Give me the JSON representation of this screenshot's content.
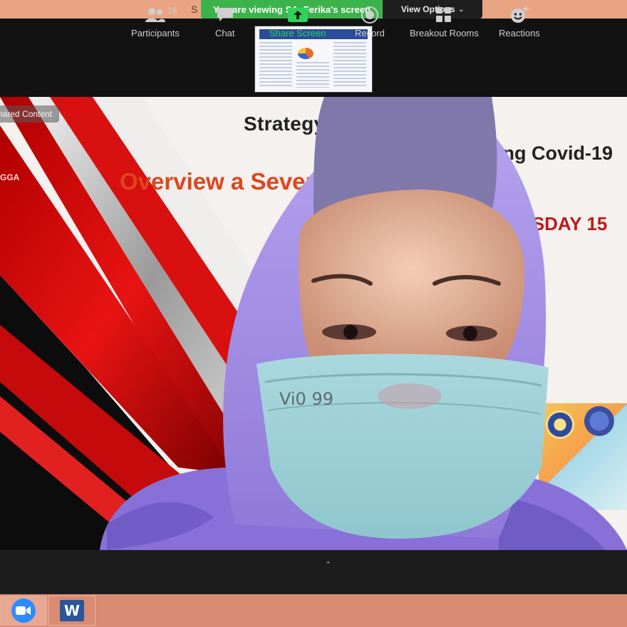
{
  "top_bar": {
    "partial_text": "S",
    "viewing_label": "You are viewing SA_Ferika's screen",
    "view_options_label": "View Options"
  },
  "shared_content": {
    "label": "hared Content",
    "slide": {
      "title_line1": "Strategy of        and Faculty of",
      "title_line2": "ing Covid-19",
      "overview": "Overview a            Several C",
      "date": "RSDAY 15",
      "speaker": "GGA"
    }
  },
  "toolbar": {
    "participants": {
      "label": "Participants",
      "count": "16"
    },
    "chat": {
      "label": "Chat"
    },
    "share_screen": {
      "label": "Share Screen"
    },
    "record": {
      "label": "Record"
    },
    "breakout": {
      "label": "Breakout Rooms"
    },
    "reactions": {
      "label": "Reactions"
    }
  },
  "taskbar": {
    "apps": [
      {
        "name": "zoom-app-icon"
      },
      {
        "name": "word-app-icon",
        "glyph": "W"
      }
    ]
  },
  "colors": {
    "share_green": "#2fd25d",
    "badge_green": "#3cb34a",
    "toolbar_bg": "#1c1c1c",
    "taskbar": "#d98c73"
  }
}
